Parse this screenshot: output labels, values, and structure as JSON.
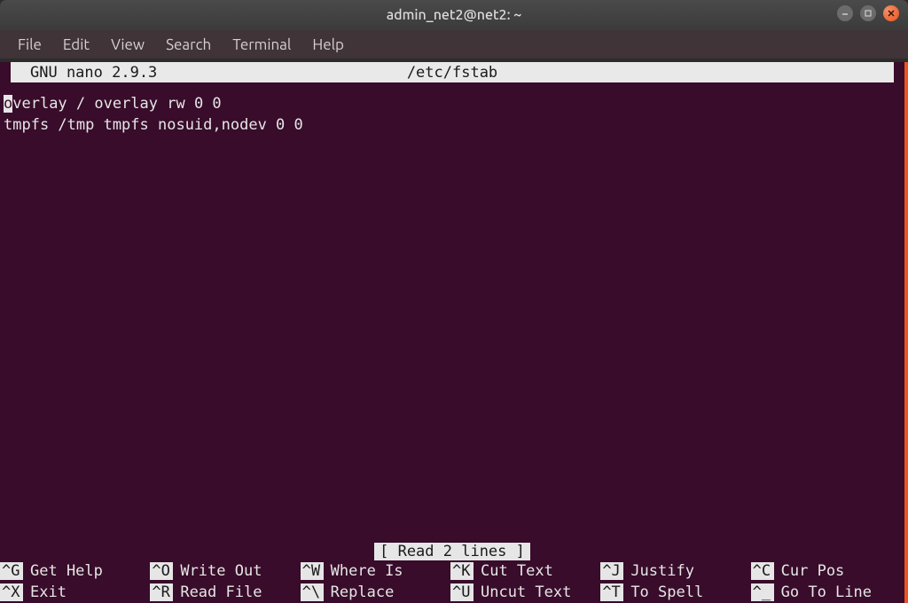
{
  "window": {
    "title": "admin_net2@net2: ~"
  },
  "menubar": {
    "items": [
      {
        "label": "File"
      },
      {
        "label": "Edit"
      },
      {
        "label": "View"
      },
      {
        "label": "Search"
      },
      {
        "label": "Terminal"
      },
      {
        "label": "Help"
      }
    ]
  },
  "nano": {
    "app_name": "GNU nano 2.9.3",
    "filename": "/etc/fstab",
    "content": {
      "line1_cursor": "o",
      "line1_rest": "verlay / overlay rw 0 0",
      "line2": "tmpfs /tmp tmpfs nosuid,nodev 0 0"
    },
    "status": "[ Read 2 lines ]",
    "shortcuts_row1": [
      {
        "key": "^G",
        "label": "Get Help"
      },
      {
        "key": "^O",
        "label": "Write Out"
      },
      {
        "key": "^W",
        "label": "Where Is"
      },
      {
        "key": "^K",
        "label": "Cut Text"
      },
      {
        "key": "^J",
        "label": "Justify"
      },
      {
        "key": "^C",
        "label": "Cur Pos"
      }
    ],
    "shortcuts_row2": [
      {
        "key": "^X",
        "label": "Exit"
      },
      {
        "key": "^R",
        "label": "Read File"
      },
      {
        "key": "^\\",
        "label": "Replace"
      },
      {
        "key": "^U",
        "label": "Uncut Text"
      },
      {
        "key": "^T",
        "label": "To Spell"
      },
      {
        "key": "^_",
        "label": "Go To Line"
      }
    ]
  }
}
